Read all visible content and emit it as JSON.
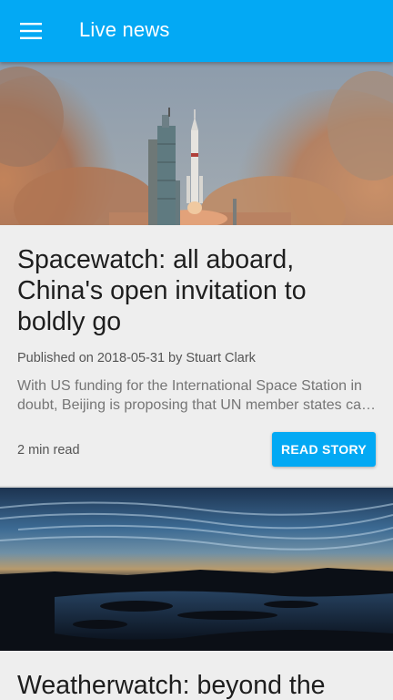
{
  "appbar": {
    "title": "Live news",
    "menu_icon": "hamburger-menu-icon"
  },
  "colors": {
    "primary": "#03a9f4",
    "background": "#eeeeee",
    "headline_text": "#1e1e1e",
    "meta_text": "#555555",
    "summary_text": "#757575"
  },
  "articles": [
    {
      "headline": "Spacewatch: all aboard, China's open invitation to boldly go",
      "published_label": "Published on",
      "date": "2018-05-31",
      "by_label": "by",
      "author": "Stuart Clark",
      "summary": "With US funding for the International Space Station in doubt, Beijing is proposing that UN member states can use its space station",
      "read_time": "2 min read",
      "button_label": "READ STORY",
      "image": "rocket-launch-photo"
    },
    {
      "headline": "Weatherwatch: beyond the",
      "image": "night-clouds-over-water-photo"
    }
  ]
}
